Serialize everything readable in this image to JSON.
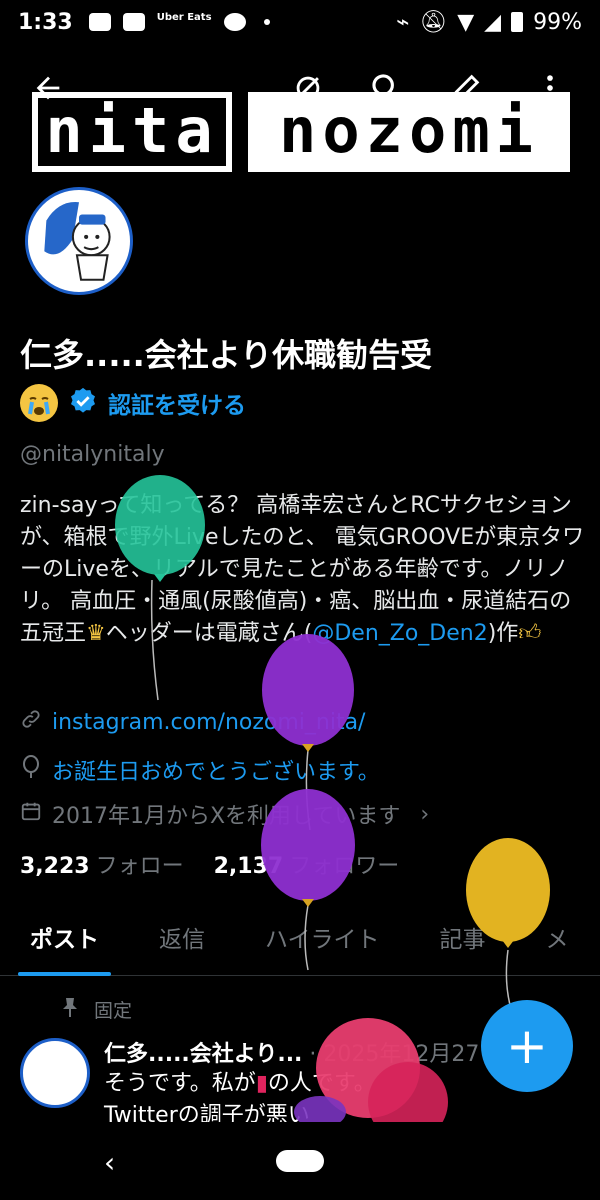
{
  "status_bar": {
    "time": "1:33",
    "app_label": "Uber Eats",
    "battery": "99%"
  },
  "header": {
    "banner_word1": "nita",
    "banner_word2": "nozomi",
    "icons": [
      "back-arrow-icon",
      "mute-icon",
      "search-icon",
      "edit-icon",
      "more-icon"
    ]
  },
  "profile": {
    "name": "仁多.....会社より休職勧告受",
    "verify_label": "認証を受ける",
    "handle": "@nitalynitaly",
    "bio_part1": "zin-sayって知ってる？ 高橋幸宏さんとRCサクセションが、箱根で野外Liveしたのと、 電気GROOVEが東京タワーのLiveを、リアルで見たことがある年齢です。ノリノリ。 高血圧・通風(尿酸値高)・癌、脳出血・尿道結石の五冠王",
    "bio_part2": "ヘッダーは電蔵さん(",
    "bio_mention": "@Den_Zo_Den2",
    "bio_part3": ")作",
    "link": "instagram.com/nozomi_nita/",
    "birthday": "お誕生日おめでとうございます。",
    "joined": "2017年1月からXを利用しています",
    "following_count": "3,223",
    "following_label": "フォロー",
    "followers_count": "2,137",
    "followers_label": "フォロワー"
  },
  "tabs": [
    "ポスト",
    "返信",
    "ハイライト",
    "記事",
    "メ"
  ],
  "pinned_post": {
    "pinned_label": "固定",
    "author": "仁多.....会社より...",
    "date": "· 2025年12月27",
    "text_line1": "そうです。私が",
    "text_line1b": "の人です。",
    "text_line2": "Twitterの調子が悪い"
  },
  "fab_label": "+",
  "colors": {
    "accent": "#1d9bf0",
    "background": "#000000",
    "secondary_text": "#71767b"
  }
}
